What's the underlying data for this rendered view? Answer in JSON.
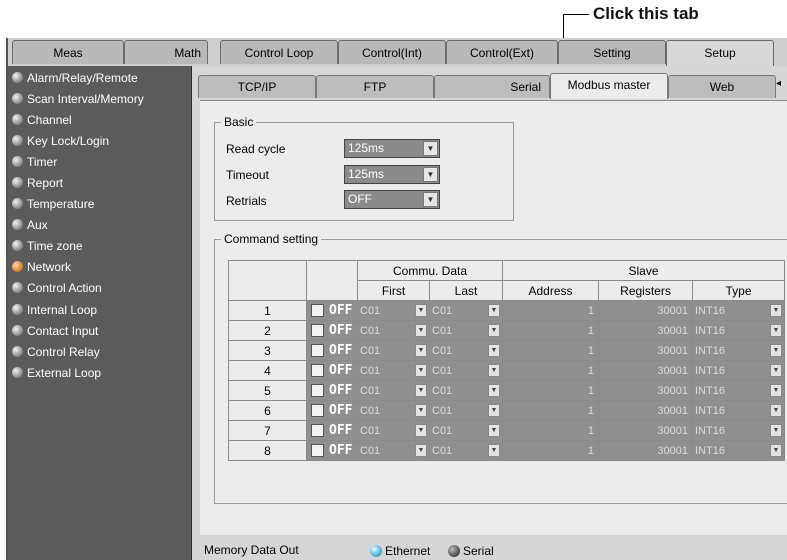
{
  "callout": {
    "text": "Click this tab"
  },
  "top_tabs": [
    {
      "label": "Meas",
      "active": false
    },
    {
      "label": "Math",
      "active": false
    },
    {
      "label": "Control Loop",
      "active": false
    },
    {
      "label": "Control(Int)",
      "active": false
    },
    {
      "label": "Control(Ext)",
      "active": false
    },
    {
      "label": "Setting",
      "active": false
    },
    {
      "label": "Setup",
      "active": true
    }
  ],
  "sidebar": {
    "items": [
      {
        "label": "Alarm/Relay/Remote"
      },
      {
        "label": "Scan Interval/Memory"
      },
      {
        "label": "Channel"
      },
      {
        "label": "Key Lock/Login"
      },
      {
        "label": "Timer"
      },
      {
        "label": "Report"
      },
      {
        "label": "Temperature"
      },
      {
        "label": "Aux"
      },
      {
        "label": "Time zone"
      },
      {
        "label": "Network",
        "active": true
      },
      {
        "label": "Control Action"
      },
      {
        "label": "Internal Loop"
      },
      {
        "label": "Contact Input"
      },
      {
        "label": "Control Relay"
      },
      {
        "label": "External Loop"
      }
    ]
  },
  "sub_tabs": [
    {
      "label": "TCP/IP"
    },
    {
      "label": "FTP"
    },
    {
      "label": "Serial"
    },
    {
      "label": "Modbus master",
      "active": true
    },
    {
      "label": "Web"
    }
  ],
  "basic": {
    "legend": "Basic",
    "read_cycle_label": "Read cycle",
    "read_cycle_value": "125ms",
    "timeout_label": "Timeout",
    "timeout_value": "125ms",
    "retrials_label": "Retrials",
    "retrials_value": "OFF"
  },
  "command": {
    "legend": "Command setting",
    "header_commu": "Commu. Data",
    "header_slave": "Slave",
    "col_first": "First",
    "col_last": "Last",
    "col_address": "Address",
    "col_registers": "Registers",
    "col_type": "Type",
    "rows": [
      {
        "no": "1",
        "state": "OFF",
        "first": "C01",
        "last": "C01",
        "address": "1",
        "registers": "30001",
        "type": "INT16"
      },
      {
        "no": "2",
        "state": "OFF",
        "first": "C01",
        "last": "C01",
        "address": "1",
        "registers": "30001",
        "type": "INT16"
      },
      {
        "no": "3",
        "state": "OFF",
        "first": "C01",
        "last": "C01",
        "address": "1",
        "registers": "30001",
        "type": "INT16"
      },
      {
        "no": "4",
        "state": "OFF",
        "first": "C01",
        "last": "C01",
        "address": "1",
        "registers": "30001",
        "type": "INT16"
      },
      {
        "no": "5",
        "state": "OFF",
        "first": "C01",
        "last": "C01",
        "address": "1",
        "registers": "30001",
        "type": "INT16"
      },
      {
        "no": "6",
        "state": "OFF",
        "first": "C01",
        "last": "C01",
        "address": "1",
        "registers": "30001",
        "type": "INT16"
      },
      {
        "no": "7",
        "state": "OFF",
        "first": "C01",
        "last": "C01",
        "address": "1",
        "registers": "30001",
        "type": "INT16"
      },
      {
        "no": "8",
        "state": "OFF",
        "first": "C01",
        "last": "C01",
        "address": "1",
        "registers": "30001",
        "type": "INT16"
      }
    ]
  },
  "memory_out": {
    "label": "Memory Data Out",
    "option_ethernet": "Ethernet",
    "option_serial": "Serial",
    "selected": "Ethernet"
  }
}
